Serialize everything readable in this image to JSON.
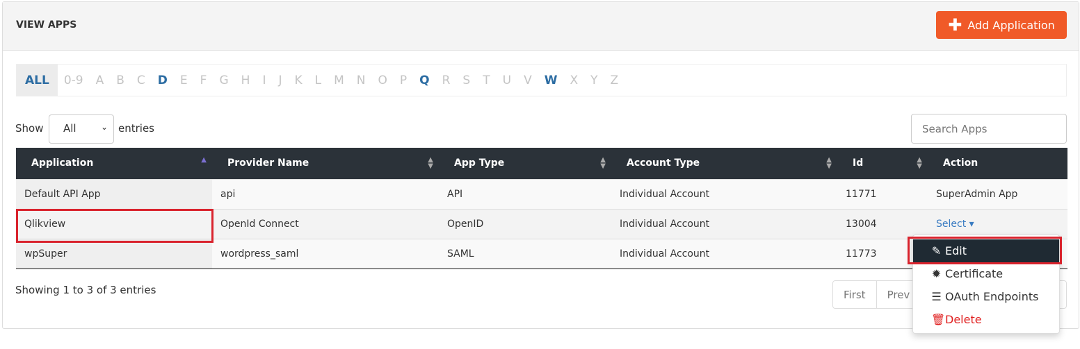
{
  "header": {
    "title": "VIEW APPS",
    "add_button": "Add Application"
  },
  "alphabet": {
    "items": [
      "ALL",
      "0-9",
      "A",
      "B",
      "C",
      "D",
      "E",
      "F",
      "G",
      "H",
      "I",
      "J",
      "K",
      "L",
      "M",
      "N",
      "O",
      "P",
      "Q",
      "R",
      "S",
      "T",
      "U",
      "V",
      "W",
      "X",
      "Y",
      "Z"
    ],
    "active": [
      "ALL",
      "D",
      "Q",
      "W"
    ]
  },
  "length": {
    "show": "Show",
    "value": "All",
    "entries": "entries"
  },
  "search": {
    "placeholder": "Search Apps"
  },
  "table": {
    "columns": [
      "Application",
      "Provider Name",
      "App Type",
      "Account Type",
      "Id",
      "Action"
    ],
    "rows": [
      [
        "Default API App",
        "api",
        "API",
        "Individual Account",
        "11771",
        "SuperAdmin App"
      ],
      [
        "Qlikview",
        "OpenId Connect",
        "OpenID",
        "Individual Account",
        "13004",
        "Select"
      ],
      [
        "wpSuper",
        "wordpress_saml",
        "SAML",
        "Individual Account",
        "11773",
        ""
      ]
    ]
  },
  "footer": {
    "info": "Showing 1 to 3 of 3 entries",
    "pager": [
      "First",
      "Prev"
    ]
  },
  "menu": {
    "items": [
      "Edit",
      "Certificate",
      "OAuth Endpoints",
      "Delete"
    ]
  },
  "colors": {
    "accent": "#f05a28",
    "header_bg": "#2b3239",
    "link": "#3a7cc2",
    "danger": "#e02020",
    "highlight": "#d9232d"
  }
}
